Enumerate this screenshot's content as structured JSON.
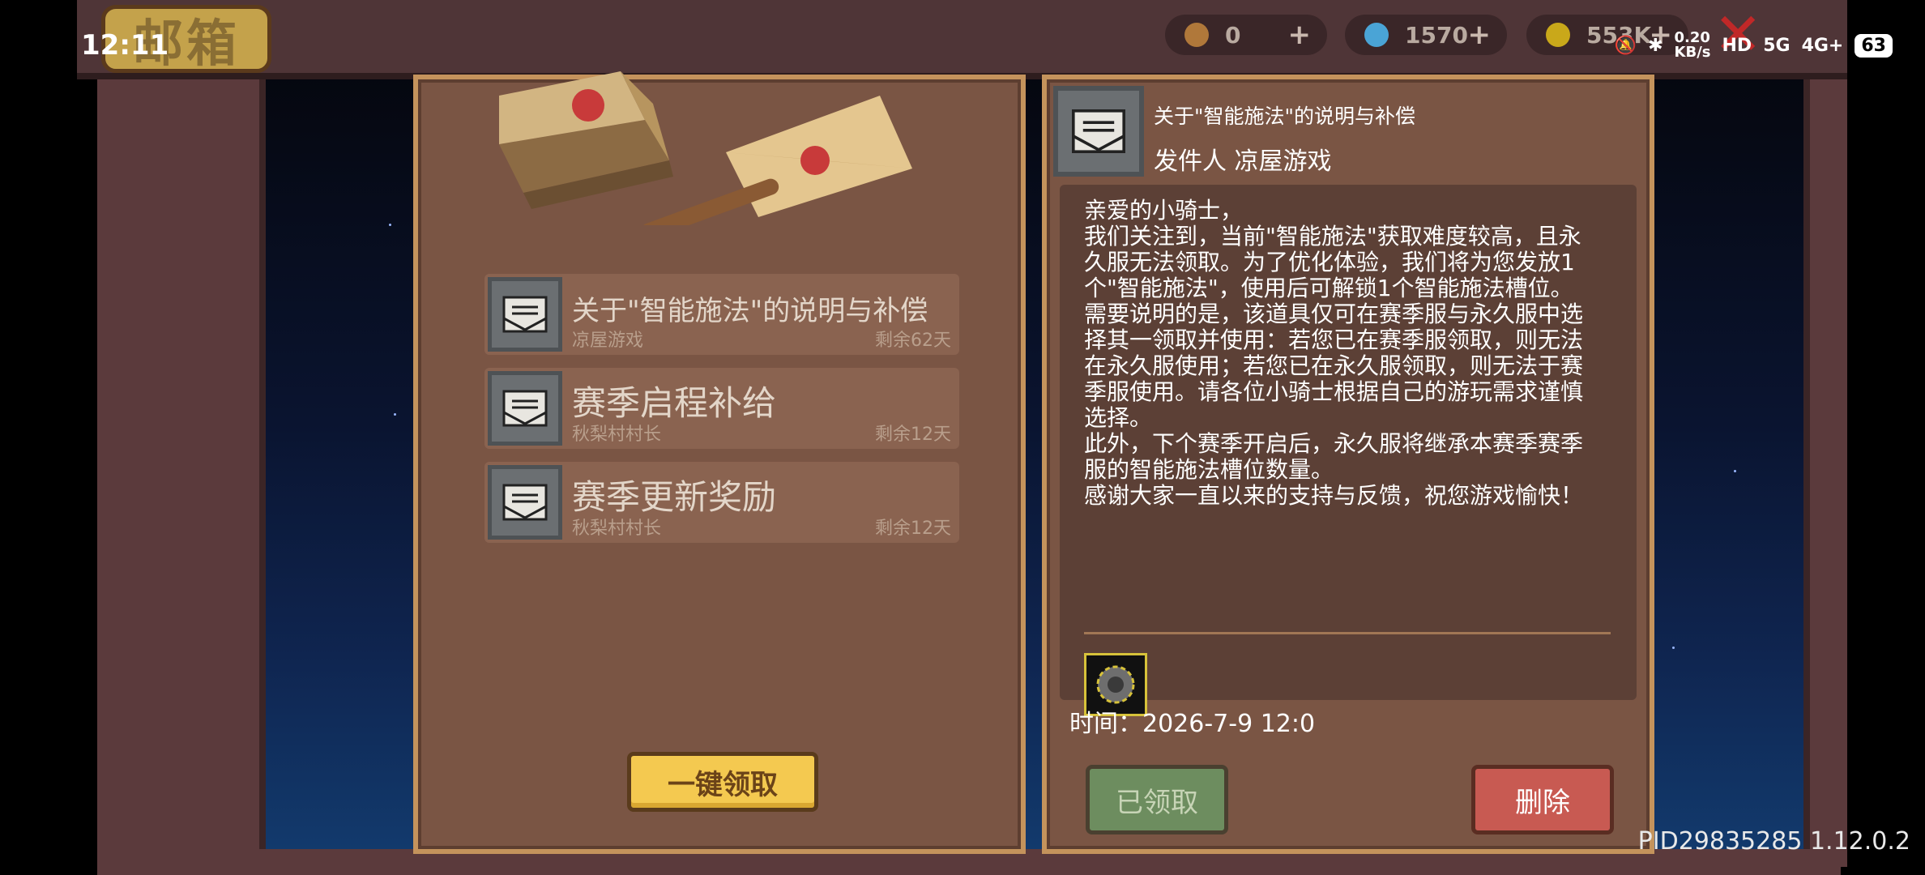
{
  "status_bar": {
    "time": "12:11",
    "speed": "0.20",
    "speed_unit": "KB/s",
    "hd": "HD",
    "net5g": "5G",
    "net4g": "4G+",
    "battery": "63"
  },
  "header": {
    "title": "邮箱"
  },
  "resources": [
    {
      "name": "material",
      "value": "0",
      "plus": "+"
    },
    {
      "name": "gems",
      "value": "1570",
      "plus": "+"
    },
    {
      "name": "coins",
      "value": "553K",
      "plus": "+"
    }
  ],
  "mail_list": [
    {
      "title": "关于\"智能施法\"的说明与补偿",
      "sender": "凉屋游戏",
      "remaining": "剩余62天"
    },
    {
      "title": "赛季启程补给",
      "sender": "秋梨村村长",
      "remaining": "剩余12天"
    },
    {
      "title": "赛季更新奖励",
      "sender": "秋梨村村长",
      "remaining": "剩余12天"
    }
  ],
  "claim_all_label": "一键领取",
  "detail": {
    "title": "关于\"智能施法\"的说明与补偿",
    "sender": "发件人 凉屋游戏",
    "body": [
      "亲爱的小骑士，",
      "我们关注到，当前\"智能施法\"获取难度较高，且永久服无法领取。为了优化体验，我们将为您发放1个\"智能施法\"，使用后可解锁1个智能施法槽位。",
      "需要说明的是，该道具仅可在赛季服与永久服中选择其一领取并使用：若您已在赛季服领取，则无法在永久服使用；若您已在永久服领取，则无法于赛季服使用。请各位小骑士根据自己的游玩需求谨慎选择。",
      "此外，下个赛季开启后，永久服将继承本赛季赛季服的智能施法槽位数量。",
      "感谢大家一直以来的支持与反馈，祝您游戏愉快！"
    ],
    "time": "时间：2026-7-9 12:0",
    "claimed_label": "已领取",
    "delete_label": "删除"
  },
  "version": "PID29835285 1.12.0.2"
}
